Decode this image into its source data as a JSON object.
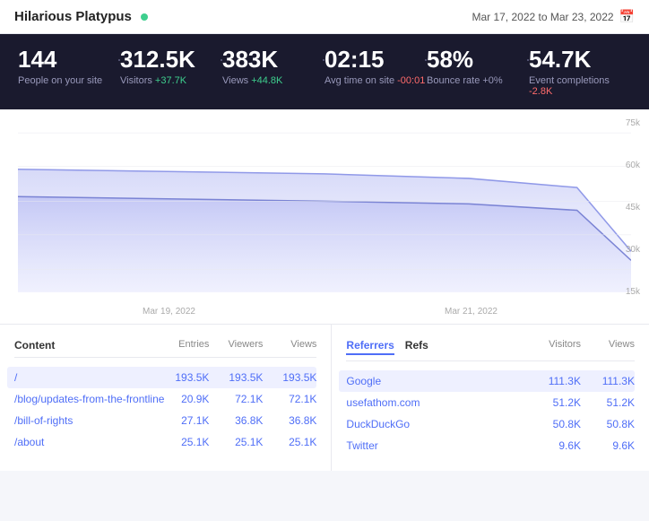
{
  "header": {
    "site_name": "Hilarious Platypus",
    "live_dot_color": "#3ecf8e",
    "date_range": "Mar 17, 2022 to Mar 23, 2022"
  },
  "stats": [
    {
      "value": "144",
      "label": "People on your site",
      "change": "",
      "change_type": ""
    },
    {
      "value": "312.5K",
      "label": "Visitors",
      "change": "+37.7K",
      "change_type": "positive"
    },
    {
      "value": "383K",
      "label": "Views",
      "change": "+44.8K",
      "change_type": "positive"
    },
    {
      "value": "02:15",
      "label": "Avg time on site",
      "change": "-00:01",
      "change_type": "negative"
    },
    {
      "value": "58%",
      "label": "Bounce rate",
      "change": "+0%",
      "change_type": "neutral"
    },
    {
      "value": "54.7K",
      "label": "Event completions",
      "change": "-2.8K",
      "change_type": "negative"
    }
  ],
  "chart": {
    "y_labels": [
      "75k",
      "60k",
      "45k",
      "30k",
      "15k"
    ],
    "x_labels": [
      "Mar 19, 2022",
      "Mar 21, 2022"
    ]
  },
  "content_table": {
    "title": "Content",
    "columns": [
      "Entries",
      "Viewers",
      "Views"
    ],
    "rows": [
      {
        "label": "/",
        "values": [
          "193.5K",
          "193.5K",
          "193.5K"
        ],
        "highlighted": true
      },
      {
        "label": "/blog/updates-from-the-frontline",
        "values": [
          "20.9K",
          "72.1K",
          "72.1K"
        ],
        "highlighted": false
      },
      {
        "label": "/bill-of-rights",
        "values": [
          "27.1K",
          "36.8K",
          "36.8K"
        ],
        "highlighted": false
      },
      {
        "label": "/about",
        "values": [
          "25.1K",
          "25.1K",
          "25.1K"
        ],
        "highlighted": true
      }
    ]
  },
  "referrers_table": {
    "tabs": [
      "Referrers",
      "Refs"
    ],
    "active_tab": "Referrers",
    "columns": [
      "Visitors",
      "Views"
    ],
    "rows": [
      {
        "label": "Google",
        "values": [
          "111.3K",
          "111.3K"
        ],
        "highlighted": true
      },
      {
        "label": "usefathom.com",
        "values": [
          "51.2K",
          "51.2K"
        ],
        "highlighted": false
      },
      {
        "label": "DuckDuckGo",
        "values": [
          "50.8K",
          "50.8K"
        ],
        "highlighted": false
      },
      {
        "label": "Twitter",
        "values": [
          "9.6K",
          "9.6K"
        ],
        "highlighted": true
      }
    ]
  }
}
